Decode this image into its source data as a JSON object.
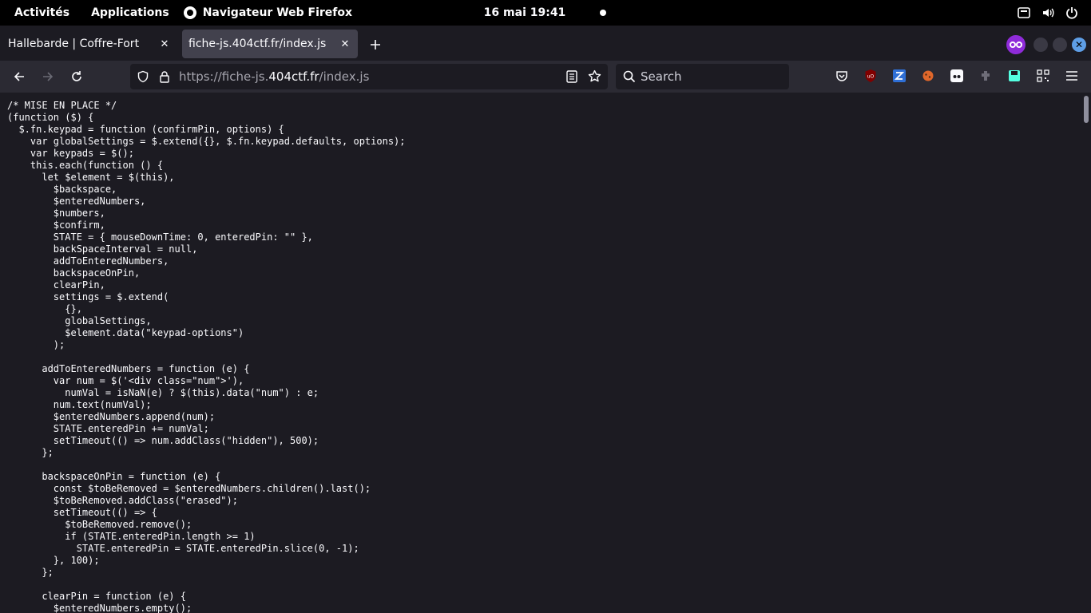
{
  "topbar": {
    "activities": "Activités",
    "applications": "Applications",
    "app_name": "Navigateur Web Firefox",
    "clock": "16 mai  19:41"
  },
  "tabs": [
    {
      "label": "Hallebarde | Coffre-Fort",
      "active": false
    },
    {
      "label": "fiche-js.404ctf.fr/index.js",
      "active": true
    }
  ],
  "urlbar": {
    "prefix": "https://fiche-js.",
    "host": "404ctf.fr",
    "path": "/index.js"
  },
  "searchbar": {
    "placeholder": "Search"
  },
  "colors": {
    "background": "#1c1b22",
    "toolbar": "#2b2a33",
    "active_tab": "#42414d",
    "text": "#fbfbfe",
    "private_accent": "#8f2bd9"
  },
  "code_lines": [
    "/* MISE EN PLACE */",
    "(function ($) {",
    "  $.fn.keypad = function (confirmPin, options) {",
    "    var globalSettings = $.extend({}, $.fn.keypad.defaults, options);",
    "    var keypads = $();",
    "    this.each(function () {",
    "      let $element = $(this),",
    "        $backspace,",
    "        $enteredNumbers,",
    "        $numbers,",
    "        $confirm,",
    "        STATE = { mouseDownTime: 0, enteredPin: \"\" },",
    "        backSpaceInterval = null,",
    "        addToEnteredNumbers,",
    "        backspaceOnPin,",
    "        clearPin,",
    "        settings = $.extend(",
    "          {},",
    "          globalSettings,",
    "          $element.data(\"keypad-options\")",
    "        );",
    "",
    "      addToEnteredNumbers = function (e) {",
    "        var num = $('<div class=\"num\">'),",
    "          numVal = isNaN(e) ? $(this).data(\"num\") : e;",
    "        num.text(numVal);",
    "        $enteredNumbers.append(num);",
    "        STATE.enteredPin += numVal;",
    "        setTimeout(() => num.addClass(\"hidden\"), 500);",
    "      };",
    "",
    "      backspaceOnPin = function (e) {",
    "        const $toBeRemoved = $enteredNumbers.children().last();",
    "        $toBeRemoved.addClass(\"erased\");",
    "        setTimeout(() => {",
    "          $toBeRemoved.remove();",
    "          if (STATE.enteredPin.length >= 1)",
    "            STATE.enteredPin = STATE.enteredPin.slice(0, -1);",
    "        }, 100);",
    "      };",
    "",
    "      clearPin = function (e) {",
    "        $enteredNumbers.empty();"
  ]
}
